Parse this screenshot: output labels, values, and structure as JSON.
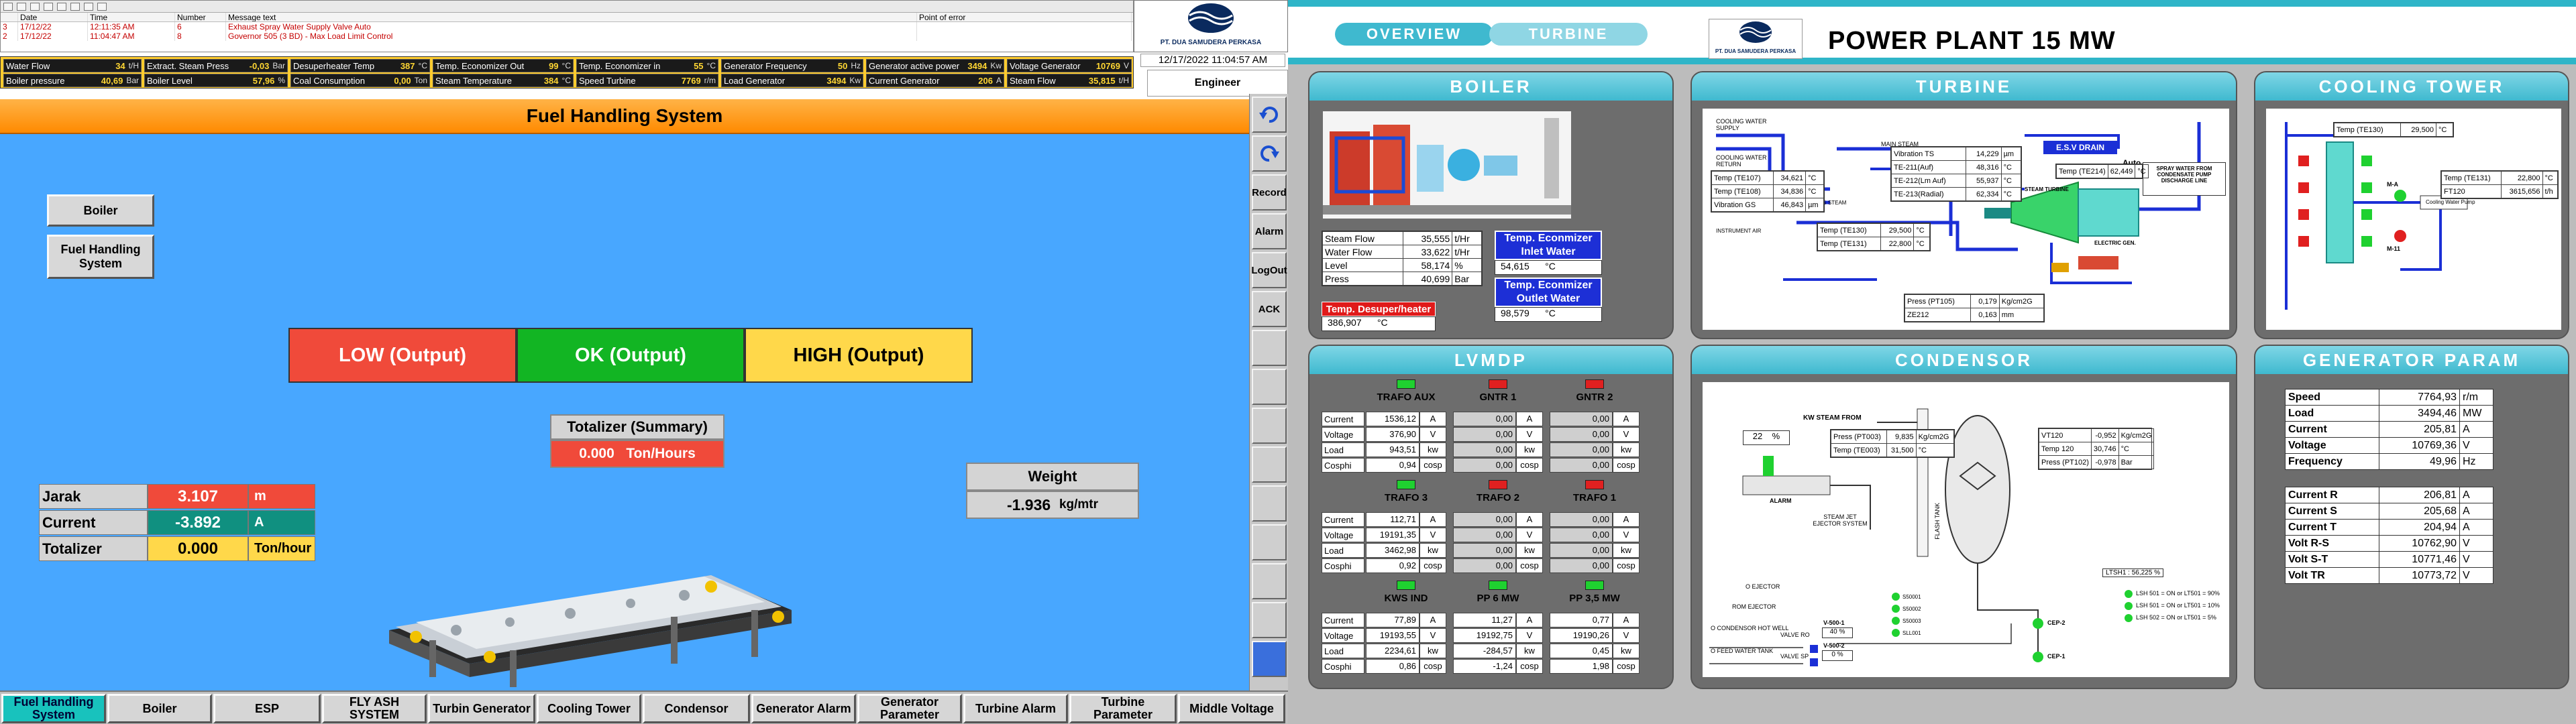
{
  "left": {
    "alarm_table": {
      "headers": [
        "",
        "Date",
        "Time",
        "Number",
        "Message text",
        "Point of error"
      ],
      "rows": [
        [
          "3",
          "17/12/22",
          "12:11:35 AM",
          "6",
          "Exhaust Spray Water Supply Valve Auto",
          ""
        ],
        [
          "2",
          "17/12/22",
          "11:04:47 AM",
          "8",
          "Governor 505 (3 BD) - Max Load Limit Control",
          ""
        ]
      ]
    },
    "status": [
      {
        "label": "Water Flow",
        "value": "34",
        "unit": "t/H"
      },
      {
        "label": "Extract. Steam Press",
        "value": "-0,03",
        "unit": "Bar"
      },
      {
        "label": "Desuperheater Temp",
        "value": "387",
        "unit": "°C"
      },
      {
        "label": "Temp. Economizer Out",
        "value": "99",
        "unit": "°C"
      },
      {
        "label": "Temp. Economizer in",
        "value": "55",
        "unit": "°C"
      },
      {
        "label": "Generator Frequency",
        "value": "50",
        "unit": "Hz"
      },
      {
        "label": "Generator active power",
        "value": "3494",
        "unit": "Kw"
      },
      {
        "label": "Voltage Generator",
        "value": "10769",
        "unit": "V"
      },
      {
        "label": "Boiler pressure",
        "value": "40,69",
        "unit": "Bar"
      },
      {
        "label": "Boiler Level",
        "value": "57,96",
        "unit": "%"
      },
      {
        "label": "Coal Consumption",
        "value": "0,00",
        "unit": "Ton"
      },
      {
        "label": "Steam Temperature",
        "value": "384",
        "unit": "°C"
      },
      {
        "label": "Speed Turbine",
        "value": "7769",
        "unit": "r/m"
      },
      {
        "label": "Load Generator",
        "value": "3494",
        "unit": "Kw"
      },
      {
        "label": "Current Generator",
        "value": "206",
        "unit": "A"
      },
      {
        "label": "Steam Flow",
        "value": "35,815",
        "unit": "t/H"
      }
    ],
    "logo_text": "PT. DUA SAMUDERA PERKASA",
    "datetime": "12/17/2022 11:04:57 AM",
    "user": "Engineer",
    "title": "Fuel Handling System",
    "left_buttons": [
      "Boiler",
      "Fuel Handling System"
    ],
    "levels": {
      "low": "LOW (Output)",
      "ok": "OK (Output)",
      "high": "HIGH (Output)"
    },
    "totalizer": {
      "title": "Totalizer (Summary)",
      "value": "0.000",
      "unit": "Ton/Hours"
    },
    "weight": {
      "title": "Weight",
      "value": "-1.936",
      "unit": "kg/mtr"
    },
    "readings": [
      {
        "label": "Jarak",
        "value": "3.107",
        "unit": "m",
        "color": "#f04a3a"
      },
      {
        "label": "Current",
        "value": "-3.892",
        "unit": "A",
        "color": "#109080"
      },
      {
        "label": "Totalizer",
        "value": "0.000",
        "unit": "Ton/hour",
        "color": "#ffd84a"
      }
    ],
    "rail_buttons": [
      "Record",
      "Alarm",
      "LogOut",
      "ACK"
    ],
    "nav": [
      "Fuel Handling System",
      "Boiler",
      "ESP",
      "FLY ASH SYSTEM",
      "Turbin Generator",
      "Cooling Tower",
      "Condensor",
      "Generator Alarm",
      "Generator Parameter",
      "Turbine Alarm",
      "Turbine Parameter",
      "Middle Voltage"
    ],
    "colors": {
      "accent": "#48a7ff",
      "title": "#ff9a1f",
      "status_bar": "#ffcc2e"
    }
  },
  "right": {
    "tabs": [
      "OVERVIEW",
      "TURBINE"
    ],
    "logo_text": "PT. DUA SAMUDERA PERKASA",
    "title": "POWER PLANT 15 MW",
    "boiler": {
      "title": "BOILER",
      "rows": [
        {
          "label": "Steam Flow",
          "value": "35,555",
          "unit": "t/Hr"
        },
        {
          "label": "Water Flow",
          "value": "33,622",
          "unit": "t/Hr"
        },
        {
          "label": "Level",
          "value": "58,174",
          "unit": "%"
        },
        {
          "label": "Press",
          "value": "40,699",
          "unit": "Bar"
        }
      ],
      "eco_in_label": "Temp. Econmizer Inlet Water",
      "eco_in_value": "54,615",
      "eco_out_label": "Temp. Econmizer Outlet Water",
      "eco_out_value": "98,579",
      "desup_label": "Temp. Desuper/heater",
      "desup_value": "386,907",
      "unit_c": "°C"
    },
    "turbine": {
      "title": "TURBINE",
      "labels": [
        "COOLING WATER SUPPLY",
        "COOLING WATER RETURN",
        "MAIN STEAM",
        "E.S.V DRAIN",
        "Auto",
        "SPRAY WATER FROM CONDENSATE PUMP DISCHARGE LINE",
        "SEALING STEAM",
        "INSTRUMENT AIR",
        "STEAM TURBINE",
        "ELECTRIC GEN."
      ],
      "vib": [
        {
          "label": "Vibration TS",
          "value": "14,229",
          "unit": "µm"
        },
        {
          "label": "TE-211(Auf)",
          "value": "48,316",
          "unit": "°C"
        },
        {
          "label": "TE-212(Lm Auf)",
          "value": "55,937",
          "unit": "°C"
        },
        {
          "label": "TE-213(Radial)",
          "value": "62,334",
          "unit": "°C"
        }
      ],
      "temps_left": [
        {
          "label": "Temp (TE107)",
          "value": "34,621",
          "unit": "°C"
        },
        {
          "label": "Temp (TE108)",
          "value": "34,836",
          "unit": "°C"
        },
        {
          "label": "Vibration GS",
          "value": "46,843",
          "unit": "µm"
        }
      ],
      "temps_mid": [
        {
          "label": "Temp (TE130)",
          "value": "29,500",
          "unit": "°C"
        },
        {
          "label": "Temp (TE131)",
          "value": "22,800",
          "unit": "°C"
        }
      ],
      "te214": {
        "label": "Temp (TE214)",
        "value": "62,449",
        "unit": "°C"
      },
      "press": [
        {
          "label": "Press (PT105)",
          "value": "0,179",
          "unit": "Kg/cm2G"
        },
        {
          "label": "ZE212",
          "value": "0,163",
          "unit": "mm"
        }
      ]
    },
    "cooling": {
      "title": "COOLING TOWER",
      "te130": {
        "label": "Temp (TE130)",
        "value": "29,500",
        "unit": "°C"
      },
      "te131": {
        "label": "Temp (TE131)",
        "value": "22,800",
        "unit": "°C"
      },
      "ft120": {
        "label": "FT120",
        "value": "3615,656",
        "unit": "t/h"
      },
      "pump_label": "Cooling Water Pump",
      "motors": [
        "M-A",
        "M-11"
      ]
    },
    "lvmdp": {
      "title": "LVMDP",
      "rowlabels": [
        "Current",
        "Voltage",
        "Load",
        "Cosphi"
      ],
      "groups": [
        {
          "name": "TRAFO AUX",
          "lamp": "#1fd130",
          "vals": [
            "1536,12",
            "376,90",
            "943,51",
            "0,94"
          ],
          "units": [
            "A",
            "V",
            "kw",
            "cosp"
          ]
        },
        {
          "name": "GNTR 1",
          "lamp": "#e02020",
          "vals": [
            "0,00",
            "0,00",
            "0,00",
            "0,00"
          ],
          "units": [
            "A",
            "V",
            "kw",
            "cosp"
          ]
        },
        {
          "name": "GNTR 2",
          "lamp": "#e02020",
          "vals": [
            "0,00",
            "0,00",
            "0,00",
            "0,00"
          ],
          "units": [
            "A",
            "V",
            "kw",
            "cosp"
          ]
        },
        {
          "name": "TRAFO 3",
          "lamp": "#1fd130",
          "vals": [
            "112,71",
            "19191,35",
            "3462,98",
            "0,92"
          ],
          "units": [
            "A",
            "V",
            "kw",
            "cosp"
          ]
        },
        {
          "name": "TRAFO 2",
          "lamp": "#e02020",
          "vals": [
            "0,00",
            "0,00",
            "0,00",
            "0,00"
          ],
          "units": [
            "A",
            "V",
            "kw",
            "cosp"
          ]
        },
        {
          "name": "TRAFO 1",
          "lamp": "#e02020",
          "vals": [
            "0,00",
            "0,00",
            "0,00",
            "0,00"
          ],
          "units": [
            "A",
            "V",
            "kw",
            "cosp"
          ]
        },
        {
          "name": "KWS IND",
          "lamp": "#1fd130",
          "vals": [
            "77,89",
            "19193,55",
            "2234,61",
            "0,86"
          ],
          "units": [
            "A",
            "V",
            "kw",
            "cosp"
          ]
        },
        {
          "name": "PP 6 MW",
          "lamp": "#1fd130",
          "vals": [
            "11,27",
            "19192,75",
            "-284,57",
            "-1,24"
          ],
          "units": [
            "A",
            "V",
            "kw",
            "cosp"
          ]
        },
        {
          "name": "PP 3,5 MW",
          "lamp": "#1fd130",
          "vals": [
            "0,77",
            "19190,26",
            "0,45",
            "1,98"
          ],
          "units": [
            "A",
            "V",
            "kw",
            "cosp"
          ]
        }
      ]
    },
    "condensor": {
      "title": "CONDENSOR",
      "level_pct": "22",
      "level_unit": "%",
      "press_rows": [
        {
          "label": "Press (PT003)",
          "value": "9,835",
          "unit": "Kg/cm2G"
        },
        {
          "label": "Temp (TE003)",
          "value": "31,500",
          "unit": "°C"
        }
      ],
      "vt_rows": [
        {
          "label": "VT120",
          "value": "-0,952",
          "unit": "Kg/cm2G"
        },
        {
          "label": "Temp 120",
          "value": "30,746",
          "unit": "°C"
        },
        {
          "label": "Press (PT102)",
          "value": "-0,978",
          "unit": "Bar"
        }
      ],
      "labels": [
        "KW STEAM FROM",
        "ALARM",
        "STEAM JET EJECTOR SYSTEM",
        "FLASH TANK",
        "LTSH1 : 56,225 %",
        "LSH 501 = ON or LT501 = 90%",
        "LSH 501 = ON or LT501 = 10%",
        "LSH 502 = ON or LT501 = 5%",
        "O EJECTOR",
        "ROM EJECTOR",
        "O CONDENSOR HOT WELL",
        "O FEED WATER TANK",
        "VALVE RO",
        "VALVE SP",
        "CEP-2",
        "CEP-1"
      ],
      "valve_vals": [
        {
          "name": "V-500-1",
          "value": "40",
          "unit": "%"
        },
        {
          "name": "V-500-2",
          "value": "0",
          "unit": "%"
        }
      ],
      "sensors": [
        "S50001",
        "S50002",
        "S50003",
        "SLL001"
      ]
    },
    "generator": {
      "title": "GENERATOR PARAM",
      "rows1": [
        {
          "label": "Speed",
          "value": "7764,93",
          "unit": "r/m"
        },
        {
          "label": "Load",
          "value": "3494,46",
          "unit": "MW"
        },
        {
          "label": "Current",
          "value": "205,81",
          "unit": "A"
        },
        {
          "label": "Voltage",
          "value": "10769,36",
          "unit": "V"
        },
        {
          "label": "Frequency",
          "value": "49,96",
          "unit": "Hz"
        }
      ],
      "rows2": [
        {
          "label": "Current R",
          "value": "206,81",
          "unit": "A"
        },
        {
          "label": "Current S",
          "value": "205,68",
          "unit": "A"
        },
        {
          "label": "Current T",
          "value": "204,94",
          "unit": "A"
        },
        {
          "label": "Volt R-S",
          "value": "10762,90",
          "unit": "V"
        },
        {
          "label": "Volt S-T",
          "value": "10771,46",
          "unit": "V"
        },
        {
          "label": "Volt TR",
          "value": "10773,72",
          "unit": "V"
        }
      ]
    }
  }
}
